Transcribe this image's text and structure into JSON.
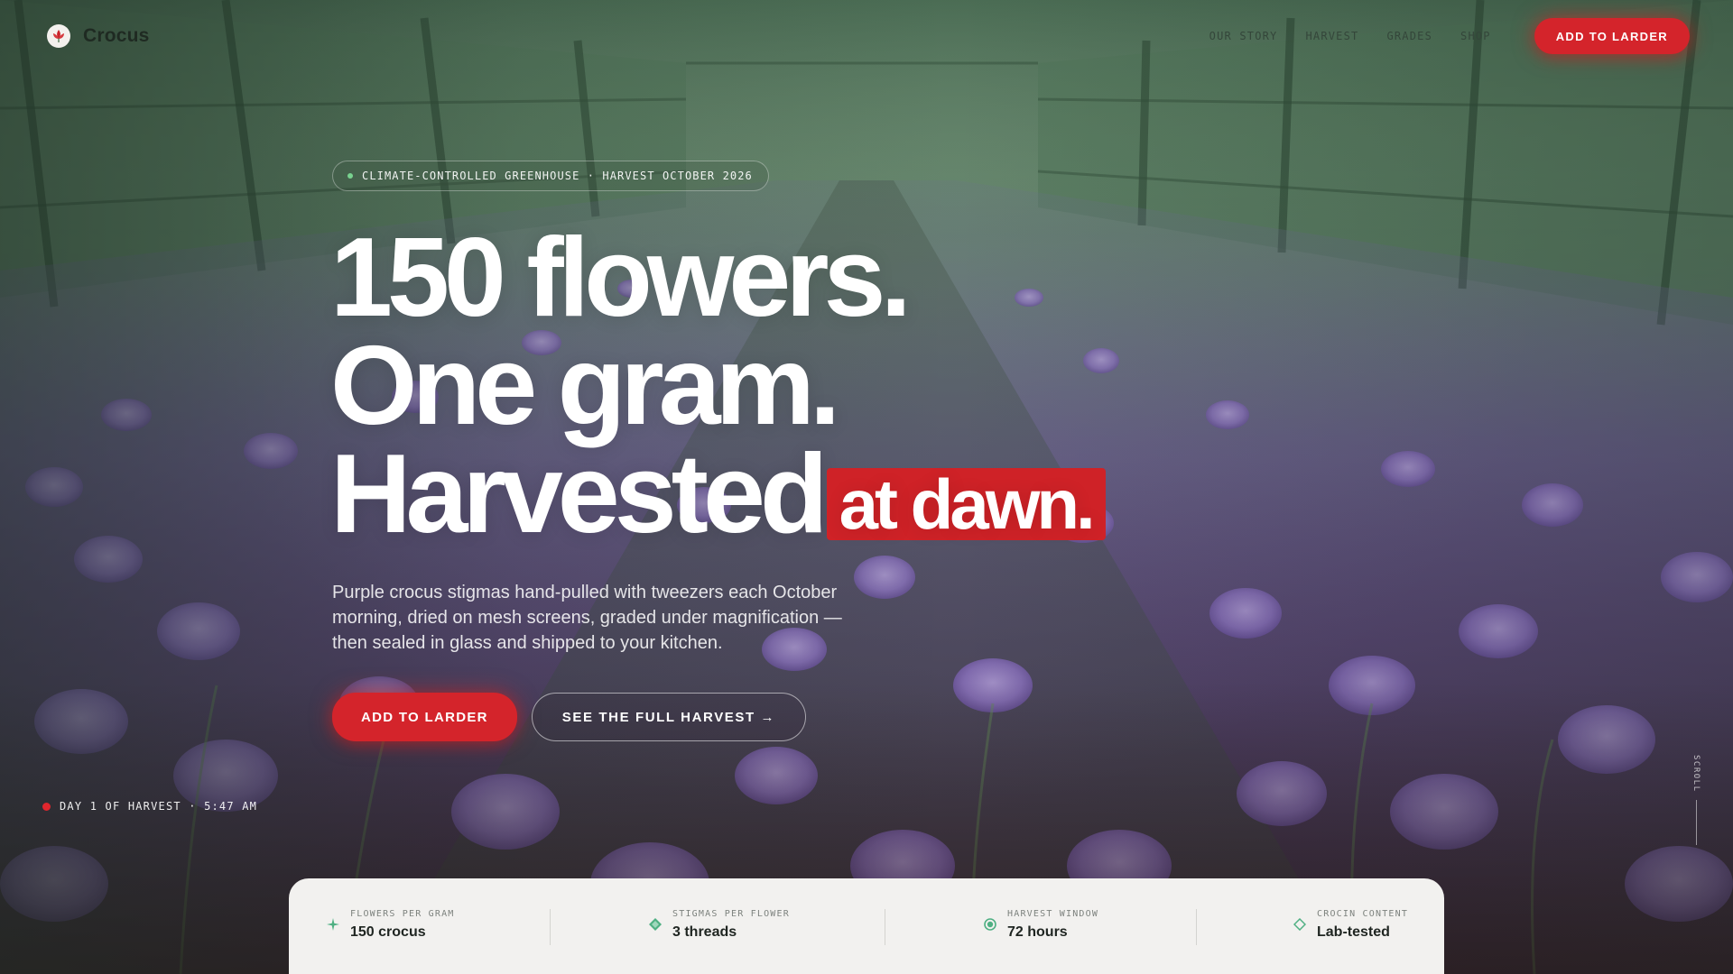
{
  "brand": {
    "name": "Crocus",
    "logo_icon": "crocus-flower-icon"
  },
  "nav": {
    "items": [
      "OUR STORY",
      "HARVEST",
      "GRADES",
      "SHOP"
    ],
    "cta_label": "ADD TO LARDER"
  },
  "hero": {
    "eyebrow": "CLIMATE-CONTROLLED GREENHOUSE · HARVEST OCTOBER 2026",
    "headline_line1": "150 flowers.",
    "headline_line2": "One gram.",
    "headline_line3": "Harvested",
    "headline_accent": "at dawn.",
    "lede": "Purple crocus stigmas hand-pulled with tweezers each October morning, dried on mesh screens, graded under magnification — then sealed in glass and shipped to your kitchen.",
    "primary_cta": "ADD TO LARDER",
    "secondary_cta": "SEE THE FULL HARVEST →"
  },
  "status": {
    "text": "DAY 1 OF HARVEST · 5:47 AM"
  },
  "scroll": {
    "label": "SCROLL"
  },
  "stats": [
    {
      "label": "FLOWERS PER GRAM",
      "value": "150 crocus",
      "icon": "sparkle-icon"
    },
    {
      "label": "STIGMAS PER FLOWER",
      "value": "3 threads",
      "icon": "diamond-filled-icon"
    },
    {
      "label": "HARVEST WINDOW",
      "value": "72 hours",
      "icon": "target-icon"
    },
    {
      "label": "CROCIN CONTENT",
      "value": "Lab-tested",
      "icon": "diamond-outline-icon"
    }
  ],
  "colors": {
    "accent_red": "#d4242b",
    "stat_icon_green": "#4fb083",
    "stats_bg": "#f2f1ef"
  }
}
